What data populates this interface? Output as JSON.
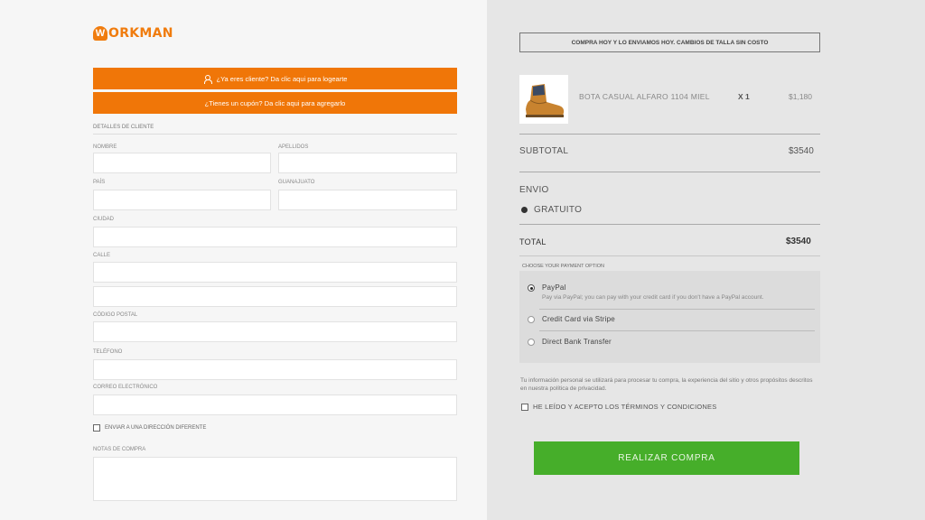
{
  "brand": {
    "logo_letter": "W",
    "name": "ORKMAN",
    "accent": "#f07608"
  },
  "login_bar": {
    "label": "¿Ya eres cliente? Da clic aqui para logearte"
  },
  "coupon_bar": {
    "label": "¿Tienes un cupón? Da clic aqui para agregarlo"
  },
  "form": {
    "section_title": "Detalles de cliente",
    "fields": {
      "nombre": "Nombre",
      "apellidos": "Apellidos",
      "pais": "País",
      "estado": "Guanajuato",
      "ciudad": "Ciudad",
      "calle": "Calle",
      "cp": "Código postal",
      "telefono": "Teléfono",
      "correo": "Correo electrónico",
      "notas": "Notas de compra"
    },
    "ship_different": "Enviar a una dirección diferente"
  },
  "summary": {
    "promo": "Compra hoy y lo enviamos hoy. Cambios de talla sin costo",
    "product": {
      "name": "BOTA CASUAL ALFARO 1104 MIEL",
      "qty": "X 1",
      "price": "$1,180"
    },
    "subtotal_label": "SUBTOTAL",
    "subtotal_value": "$3540",
    "shipping_label": "ENVIO",
    "shipping_option": "GRATUITO",
    "total_label": "TOTAL",
    "total_value": "$3540"
  },
  "payment": {
    "title": "Choose your payment option",
    "options": [
      {
        "label": "PayPal",
        "desc": "Pay via PayPal; you can pay with your credit card if you don't have a PayPal account.",
        "selected": true
      },
      {
        "label": "Credit Card via Stripe",
        "selected": false
      },
      {
        "label": "Direct Bank Transfer",
        "selected": false
      }
    ]
  },
  "privacy_text": "Tu información personal se utilizará para procesar tu compra, la experiencia del sitio y otros propósitos descritos en nuestra política de privacidad.",
  "terms_label": "He leído y acepto los términos y condiciones",
  "submit_label": "Realizar compra",
  "colors": {
    "submit": "#46ae2a",
    "left_bg": "#f6f6f6",
    "right_bg": "#e6e6e6"
  }
}
